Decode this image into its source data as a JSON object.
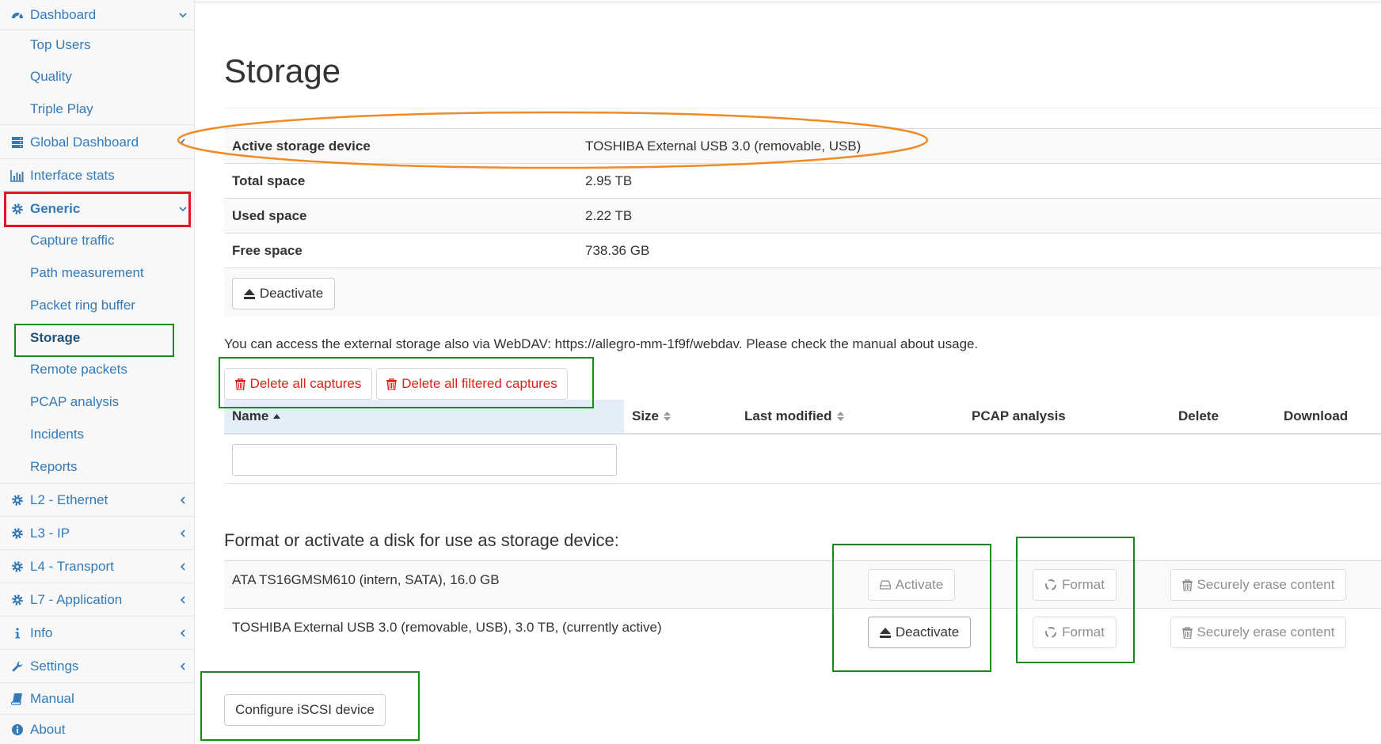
{
  "sidebar": {
    "items": [
      {
        "label": "Dashboard",
        "icon": "dashboard-icon",
        "chevron": "down"
      },
      {
        "label": "Top Users"
      },
      {
        "label": "Quality"
      },
      {
        "label": "Triple Play"
      },
      {
        "label": "Global Dashboard",
        "icon": "server-icon",
        "chevron": "left"
      },
      {
        "label": "Interface stats",
        "icon": "bar-chart-icon"
      },
      {
        "label": "Generic",
        "icon": "gear-icon",
        "chevron": "down"
      },
      {
        "label": "Capture traffic"
      },
      {
        "label": "Path measurement"
      },
      {
        "label": "Packet ring buffer"
      },
      {
        "label": "Storage"
      },
      {
        "label": "Remote packets"
      },
      {
        "label": "PCAP analysis"
      },
      {
        "label": "Incidents"
      },
      {
        "label": "Reports"
      },
      {
        "label": "L2 - Ethernet",
        "icon": "gear-icon",
        "chevron": "left"
      },
      {
        "label": "L3 - IP",
        "icon": "gear-icon",
        "chevron": "left"
      },
      {
        "label": "L4 - Transport",
        "icon": "gear-icon",
        "chevron": "left"
      },
      {
        "label": "L7 - Application",
        "icon": "gear-icon",
        "chevron": "left"
      },
      {
        "label": "Info",
        "icon": "info-icon",
        "chevron": "left"
      },
      {
        "label": "Settings",
        "icon": "wrench-icon",
        "chevron": "left"
      },
      {
        "label": "Manual",
        "icon": "book-icon"
      },
      {
        "label": "About",
        "icon": "info-circle-icon"
      }
    ]
  },
  "page": {
    "title": "Storage"
  },
  "storage_info": {
    "rows": [
      {
        "key": "Active storage device",
        "value": "TOSHIBA External USB 3.0 (removable, USB)"
      },
      {
        "key": "Total space",
        "value": "2.95 TB"
      },
      {
        "key": "Used space",
        "value": "2.22 TB"
      },
      {
        "key": "Free space",
        "value": "738.36 GB"
      }
    ],
    "deactivate_label": "Deactivate"
  },
  "webdav_note": "You can access the external storage also via WebDAV: https://allegro-mm-1f9f/webdav. Please check the manual about usage.",
  "captures": {
    "delete_all_label": "Delete all captures",
    "delete_filtered_label": "Delete all filtered captures",
    "columns": [
      "Name",
      "Size",
      "Last modified",
      "PCAP analysis",
      "Delete",
      "Download"
    ],
    "filter_value": ""
  },
  "disks": {
    "heading": "Format or activate a disk for use as storage device:",
    "rows": [
      {
        "name": "ATA TS16GMSM610 (intern, SATA), 16.0 GB",
        "action_label": "Activate",
        "format_label": "Format",
        "erase_label": "Securely erase content"
      },
      {
        "name": "TOSHIBA External USB 3.0 (removable, USB), 3.0 TB, (currently active)",
        "action_label": "Deactivate",
        "format_label": "Format",
        "erase_label": "Securely erase content"
      }
    ],
    "iscsi_label": "Configure iSCSI device"
  },
  "colors": {
    "link": "#337ab7",
    "danger": "#d9241c",
    "annotation_green": "#1a8a1a",
    "annotation_red": "#e0161c",
    "annotation_orange": "#f08a24"
  }
}
